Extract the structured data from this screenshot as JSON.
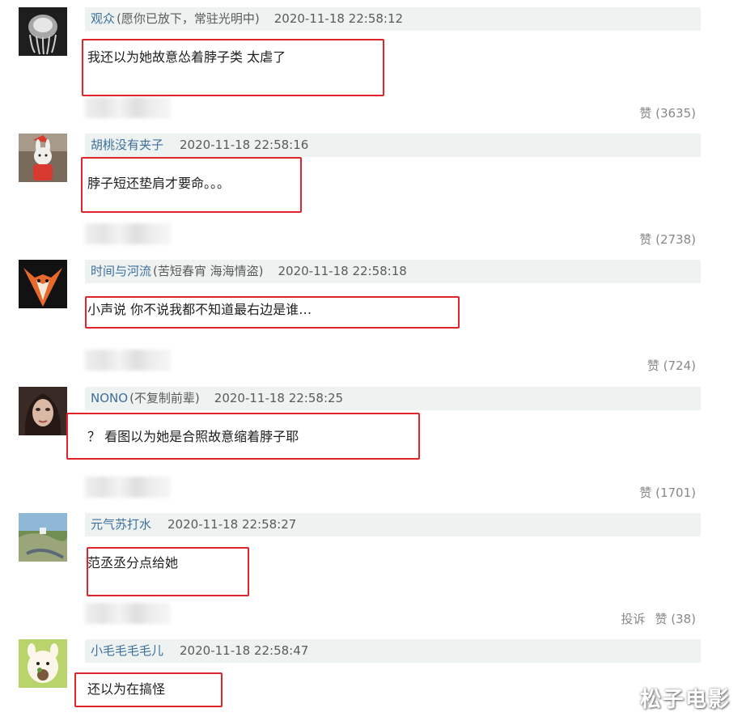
{
  "comments": [
    {
      "username": "观众",
      "tag": "(愿你已放下，常驻光明中)",
      "time": "2020-11-18 22:58:12",
      "text": "我还以为她故意怂着脖子类 太虐了",
      "like": "赞 (3635)",
      "avatar": "jellyfish-avatar"
    },
    {
      "username": "胡桃没有夹子",
      "tag": "",
      "time": "2020-11-18 22:58:16",
      "text": "脖子短还垫肩才要命。。。",
      "like": "赞 (2738)",
      "avatar": "rabbit-santa-avatar"
    },
    {
      "username": "时间与河流",
      "tag": "(苦短春宵 海海情盗)",
      "time": "2020-11-18 22:58:18",
      "text": "小声说 你不说我都不知道最右边是谁…",
      "like": "赞 (724)",
      "avatar": "fox-avatar"
    },
    {
      "username": "NONO",
      "tag": "(不复制前辈)",
      "time": "2020-11-18 22:58:25",
      "text": "？ 看图以为她是合照故意缩着脖子耶",
      "like": "赞 (1701)",
      "avatar": "woman-portrait-avatar"
    },
    {
      "username": "元气苏打水",
      "tag": "",
      "time": "2020-11-18 22:58:27",
      "text": "范丞丞分点给她",
      "like": "赞 (38)",
      "report": "投诉",
      "avatar": "landscape-avatar"
    },
    {
      "username": "小毛毛毛毛儿",
      "tag": "",
      "time": "2020-11-18 22:58:47",
      "text": "还以为在搞怪",
      "avatar": "alpaca-avatar"
    }
  ],
  "watermark": "松子电影",
  "colors": {
    "username": "#3e6f9c",
    "header_bg": "#eef3f2",
    "highlight": "#e0242b"
  }
}
